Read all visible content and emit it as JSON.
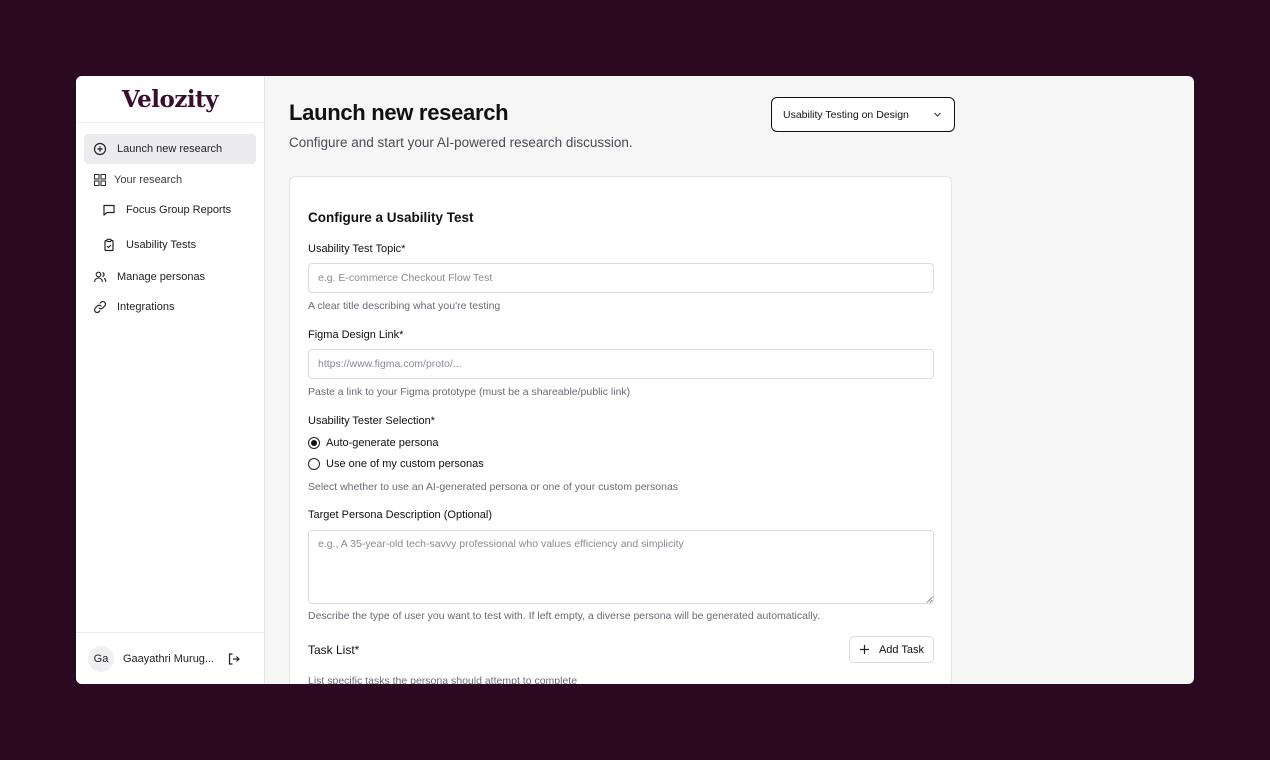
{
  "brand": {
    "logo_text": "Velozity"
  },
  "sidebar": {
    "launch": {
      "label": "Launch new research",
      "icon": "plus-circle-icon"
    },
    "your_research": {
      "label": "Your research",
      "icon": "grid-icon"
    },
    "sub_items": [
      {
        "label": "Focus Group Reports",
        "icon": "chat-icon"
      },
      {
        "label": "Usability Tests",
        "icon": "clipboard-icon"
      }
    ],
    "manage_personas": {
      "label": "Manage personas",
      "icon": "users-icon"
    },
    "integrations": {
      "label": "Integrations",
      "icon": "link-icon"
    },
    "user": {
      "initials": "Ga",
      "name": "Gaayathri Murug...",
      "logout_icon": "logout-icon"
    }
  },
  "header": {
    "title": "Launch new research",
    "subtitle": "Configure and start your AI-powered research discussion.",
    "mode_select": {
      "value": "Usability Testing on Design"
    }
  },
  "form": {
    "title": "Configure a Usability Test",
    "topic": {
      "label": "Usability Test Topic*",
      "placeholder": "e.g. E-commerce Checkout Flow Test",
      "hint": "A clear title describing what you're testing"
    },
    "figma": {
      "label": "Figma Design Link*",
      "placeholder": "https://www.figma.com/proto/...",
      "hint": "Paste a link to your Figma prototype (must be a shareable/public link)"
    },
    "tester": {
      "label": "Usability Tester Selection*",
      "options": [
        "Auto-generate persona",
        "Use one of my custom personas"
      ],
      "selected": "Auto-generate persona",
      "hint": "Select whether to use an AI-generated persona or one of your custom personas"
    },
    "persona": {
      "label": "Target Persona Description (Optional)",
      "placeholder": "e.g., A 35-year-old tech-savvy professional who values efficiency and simplicity",
      "hint": "Describe the type of user you want to test with. If left empty, a diverse persona will be generated automatically."
    },
    "tasks": {
      "label": "Task List*",
      "add_label": "Add Task",
      "hint": "List specific tasks the persona should attempt to complete"
    }
  },
  "colors": {
    "background": "#2b0a21",
    "logo": "#3a0f2c",
    "active_nav": "#ececef"
  }
}
